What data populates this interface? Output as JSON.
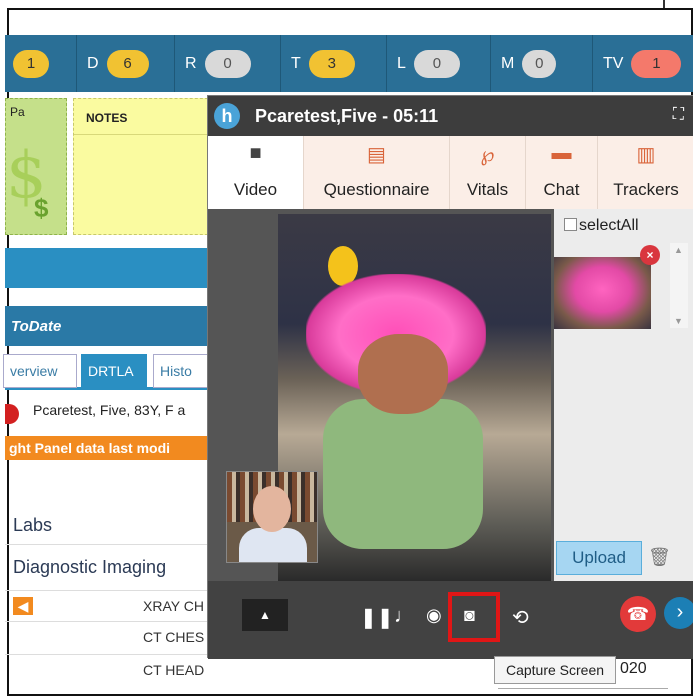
{
  "counters": [
    {
      "letter": "",
      "value": "1",
      "color": "y"
    },
    {
      "letter": "D",
      "value": "6",
      "color": "y"
    },
    {
      "letter": "R",
      "value": "0",
      "color": "g"
    },
    {
      "letter": "T",
      "value": "3",
      "color": "y"
    },
    {
      "letter": "L",
      "value": "0",
      "color": "g"
    },
    {
      "letter": "M",
      "value": "0",
      "color": "g"
    },
    {
      "letter": "TV",
      "value": "1",
      "color": "r"
    }
  ],
  "panels": {
    "pa_label": "Pa",
    "notes_label": "NOTES",
    "dollar": "$",
    "dollar_small": "$"
  },
  "uptodate": "ToDate",
  "tabs": {
    "overview": "verview",
    "drtla": "DRTLA",
    "history": "Histo"
  },
  "patient_line": "Pcaretest, Five, 83Y, F a",
  "orange_banner": "ght Panel data last modi",
  "sections": {
    "labs": "Labs",
    "diagnostic_imaging": "Diagnostic Imaging"
  },
  "imaging_rows": [
    "XRAY CH",
    "CT CHES",
    "CT HEAD"
  ],
  "row_right_text": "020",
  "video": {
    "logo": "h",
    "title": "Pcaretest,Five - 05:11",
    "fullscreen_glyph": "⛶",
    "tabs": [
      {
        "label": "Video",
        "icon": "videocam-icon",
        "glyph": "■"
      },
      {
        "label": "Questionnaire",
        "icon": "document-icon",
        "glyph": "▤"
      },
      {
        "label": "Vitals",
        "icon": "stethoscope-icon",
        "glyph": "℘"
      },
      {
        "label": "Chat",
        "icon": "chat-icon",
        "glyph": "▬"
      },
      {
        "label": "Trackers",
        "icon": "chart-icon",
        "glyph": "▥"
      }
    ],
    "select_all": "selectAll",
    "upload": "Upload",
    "tooltip": "Capture Screen"
  }
}
